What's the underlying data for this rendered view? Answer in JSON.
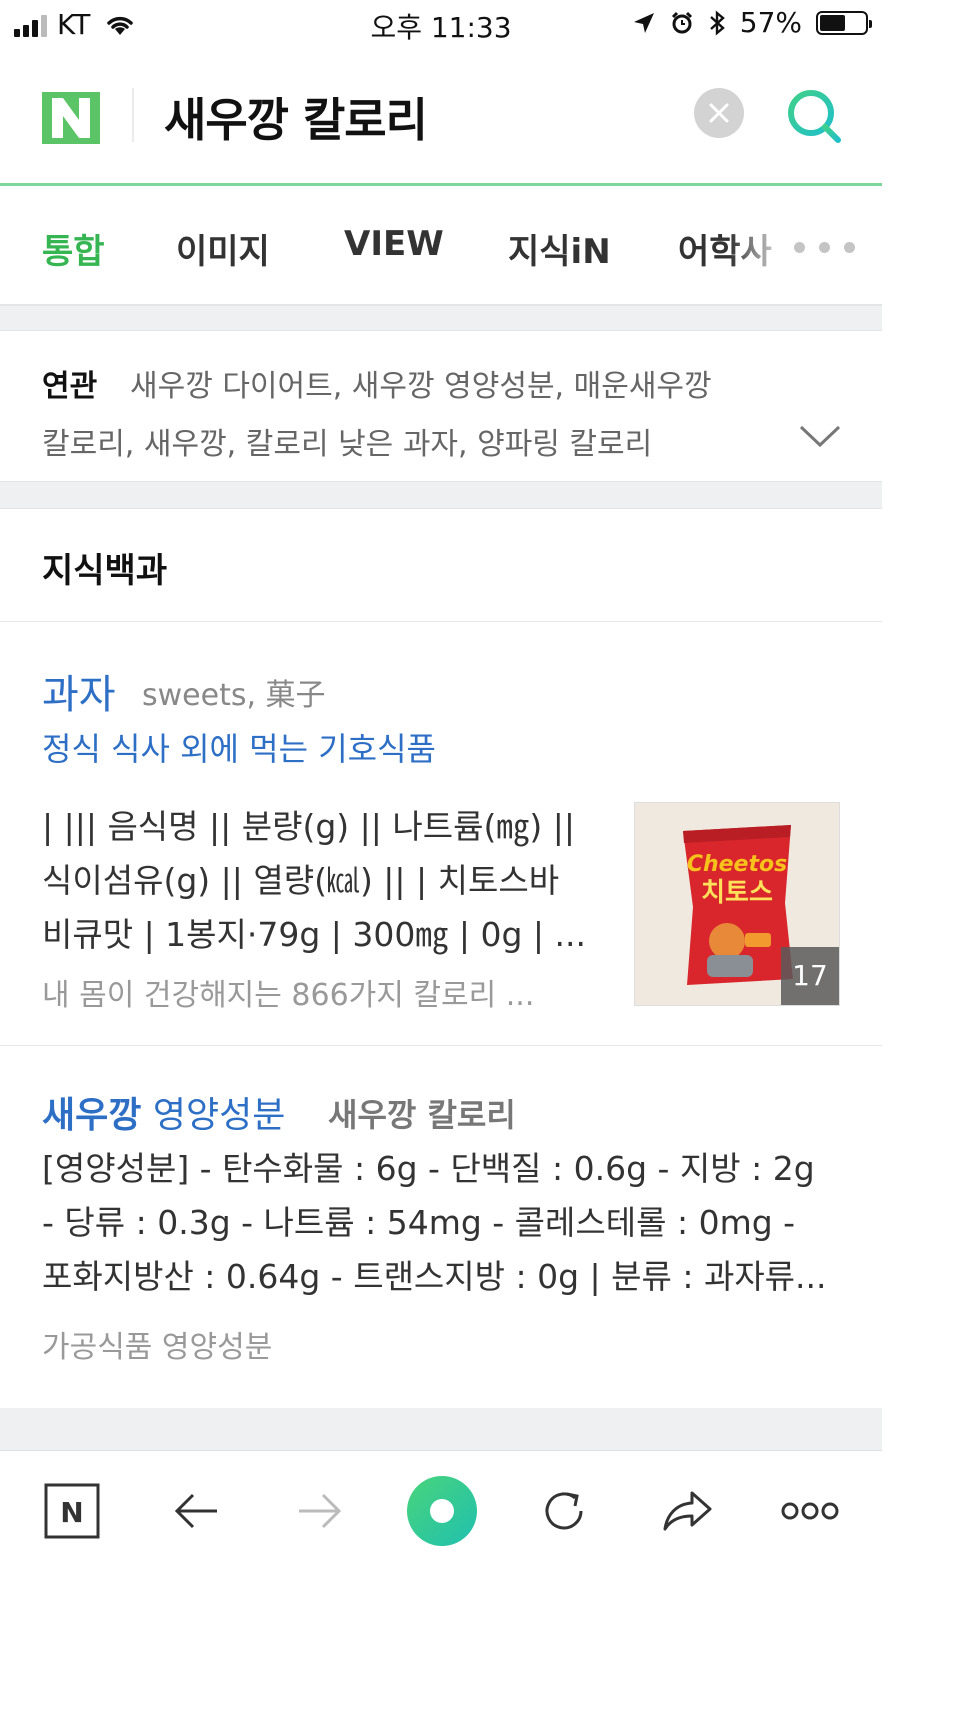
{
  "status_bar": {
    "carrier": "KT",
    "time": "오후 11:33",
    "battery": "57%",
    "battery_level": 0.57
  },
  "search": {
    "query": "새우깡 칼로리",
    "logo_letter": "N"
  },
  "tabs": [
    {
      "label": "통합",
      "active": true
    },
    {
      "label": "이미지"
    },
    {
      "label": "VIEW"
    },
    {
      "label": "지식iN"
    },
    {
      "label": "어학사"
    }
  ],
  "related": {
    "label": "연관",
    "line1": "새우깡 다이어트, 새우깡 영양성분, 매운새우깡",
    "line2": "칼로리, 새우깡, 칼로리 낮은 과자, 양파링 칼로리"
  },
  "section_title": "지식백과",
  "result1": {
    "title": "과자",
    "subtitle": "sweets, 菓子",
    "description": "정식 식사 외에 먹는 기호식품",
    "body": [
      "| ||| 음식명 || 분량(g) || 나트륨(㎎) ||",
      "식이섬유(g) || 열량(㎉) || | 치토스바",
      "비큐맛 | 1봉지·79g | 300㎎ | 0g | ..."
    ],
    "source": "내 몸이 건강해지는 866가지 칼로리 ...",
    "thumb_count": "17",
    "thumb_brand": "Cheetos",
    "thumb_name": "치토스"
  },
  "result2": {
    "title_bold": "새우깡",
    "title_rest": "영양성분",
    "tag": "새우깡 칼로리",
    "body": [
      "[영양성분] - 탄수화물 : 6g - 단백질 : 0.6g - 지방 : 2g",
      "- 당류 : 0.3g - 나트륨 : 54mg - 콜레스테롤 : 0mg -",
      "포화지방산 : 0.64g - 트랜스지방 : 0g | 분류 : 과자류..."
    ],
    "source": "가공식품 영양성분"
  },
  "toolbar": {
    "home_letter": "N"
  },
  "colors": {
    "naver_green": "#5ac466",
    "active_tab": "#35b652",
    "link_blue": "#2e6fc6",
    "divider_bg": "#eef0f2"
  }
}
